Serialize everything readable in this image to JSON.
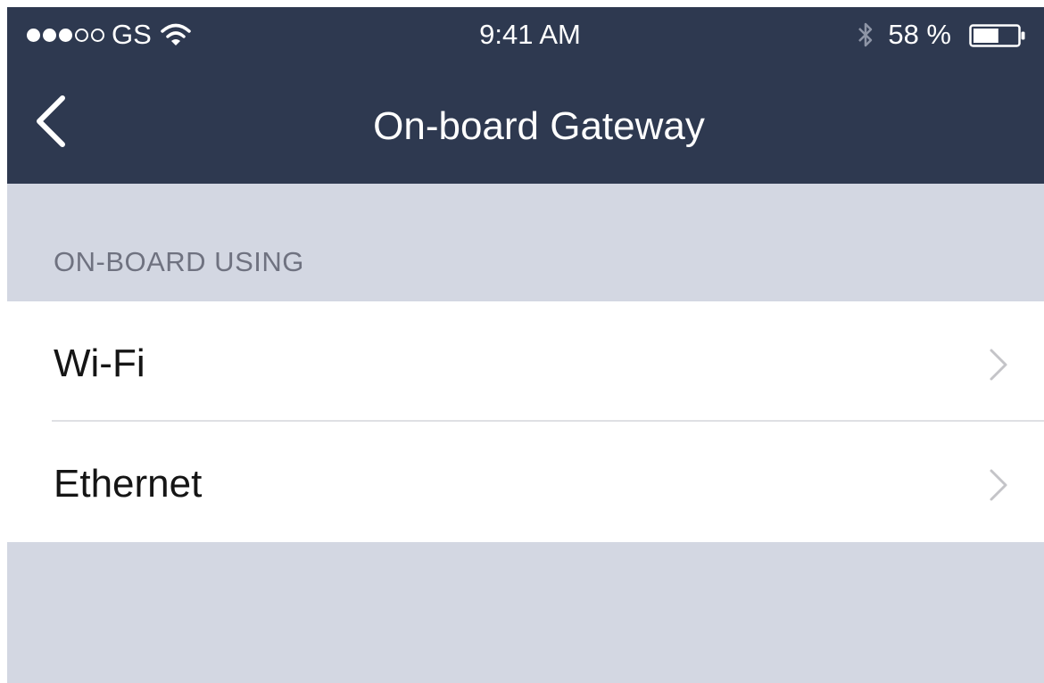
{
  "status_bar": {
    "signal_filled": 3,
    "signal_empty": 2,
    "carrier": "GS",
    "time": "9:41 AM",
    "battery_percent": "58 %",
    "battery_level": 0.58
  },
  "nav": {
    "title": "On-board Gateway",
    "back_icon": "chevron-left-icon"
  },
  "section": {
    "title": "ON-BOARD USING"
  },
  "list": {
    "items": [
      {
        "label": "Wi-Fi",
        "icon": "chevron-right-icon"
      },
      {
        "label": "Ethernet",
        "icon": "chevron-right-icon"
      }
    ]
  },
  "colors": {
    "topbar_bg": "#2e3950",
    "grouped_bg": "#d3d7e2",
    "section_text": "#6f7280",
    "row_text": "#151515",
    "chevron": "#c4c4c8",
    "divider": "#dfe0e4"
  }
}
